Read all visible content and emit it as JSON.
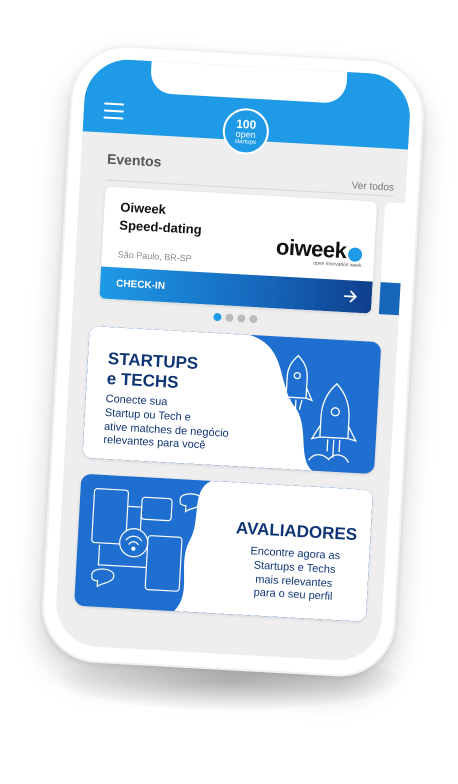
{
  "header": {
    "logo_line1": "100",
    "logo_line2": "open",
    "logo_line3": "startups"
  },
  "events": {
    "title": "Eventos",
    "see_all": "Ver todos",
    "card": {
      "title_line1": "Oiweek",
      "title_line2": "Speed-dating",
      "location": "São Paulo, BR-SP",
      "brand": "oiweek",
      "brand_tagline": "open innovation week",
      "checkin": "CHECK-IN"
    },
    "pagination": {
      "pages": 4,
      "active": 1
    }
  },
  "promos": [
    {
      "title_line1": "STARTUPS",
      "title_line2": "e TECHS",
      "line1": "Conecte sua",
      "line2": "Startup ou Tech e",
      "line3": "ative matches de negócio",
      "line4": "relevantes para você"
    },
    {
      "title": "AVALIADORES",
      "line1": "Encontre agora as",
      "line2": "Startups e Techs",
      "line3": "mais relevantes",
      "line4": "para o seu perfil"
    }
  ],
  "colors": {
    "primary": "#1e9ae6",
    "navy": "#0f3575",
    "promo_blue": "#1e6fcf",
    "screen_bg": "#eeeeee"
  }
}
